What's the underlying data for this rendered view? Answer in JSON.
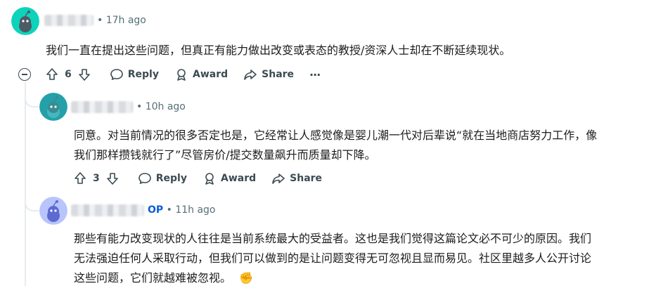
{
  "comments": [
    {
      "time": "• 17h ago",
      "body": "我们一直在提出这些问题，但真正有能力做出改变或表态的教授/资深人士却在不断延续现状。",
      "votes": "6",
      "reply": "Reply",
      "award": "Award",
      "share": "Share",
      "more": "···",
      "avatar_color": "#0dd3bb"
    },
    {
      "time": "• 10h ago",
      "body_line1": "同意。对当前情况的很多否定也是，它经常让人感觉像是婴儿潮一代对后辈说“就在当地商店努力工作，像",
      "body_line2": "我们那样攒钱就行了”尽管房价/提交数量飙升而质量却下降。",
      "votes": "3",
      "reply": "Reply",
      "award": "Award",
      "share": "Share",
      "avatar_color": "#24a0a8"
    },
    {
      "op_badge": "OP",
      "time": "• 11h ago",
      "body_line1": "那些有能力改变现状的人往往是当前系统最大的受益者。这也是我们觉得这篇论文必不可少的原因。我们",
      "body_line2": "无法强迫任何人采取行动，但我们可以做到的是让问题变得无可忽视且显而易见。社区里越多人公开讨论",
      "body_line3": "这些问题，它们就越难被忽视。",
      "emoji": "✊",
      "avatar_color": "#b8c5fc"
    }
  ]
}
